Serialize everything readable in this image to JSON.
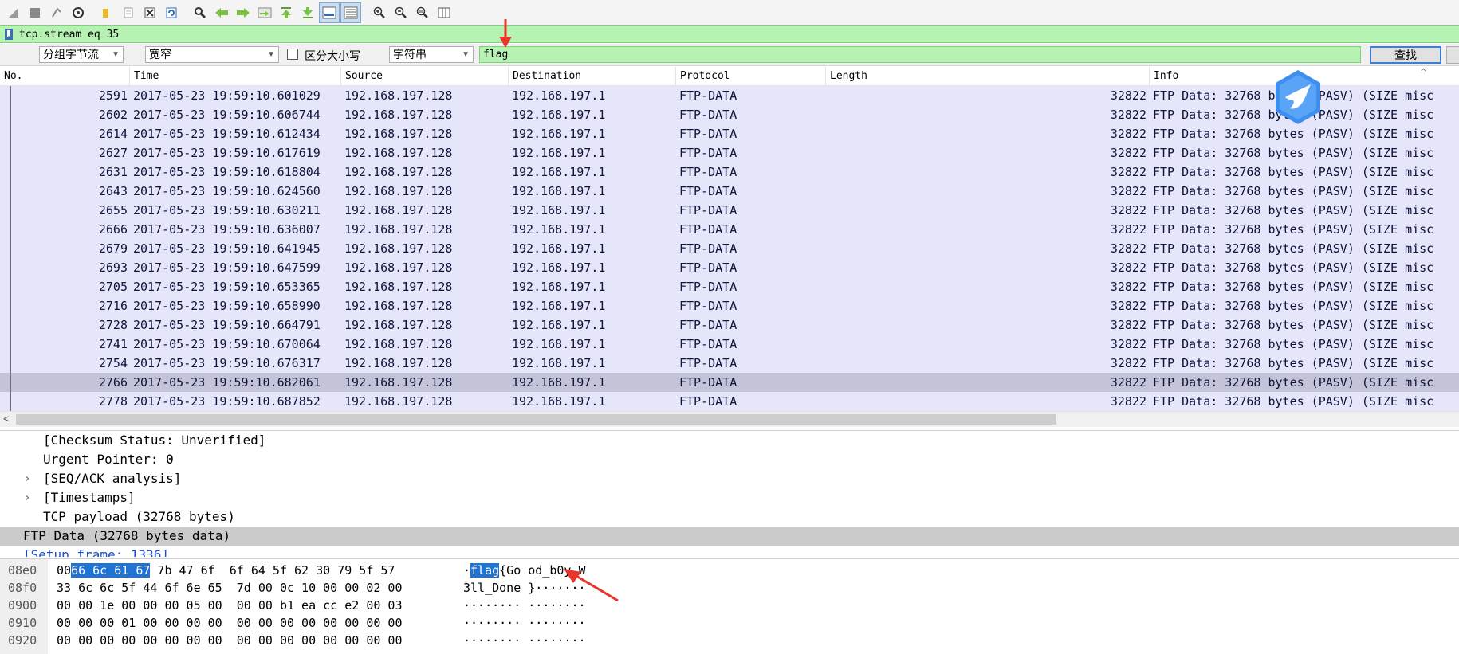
{
  "toolbar": {
    "buttons": [
      "stop-capture-icon",
      "stop-square-icon",
      "restart-capture-icon",
      "capture-options-icon",
      "open-file-icon",
      "save-file-icon",
      "close-file-icon",
      "reload-file-icon",
      "find-packet-icon",
      "go-back-icon",
      "go-forward-icon",
      "go-to-packet-icon",
      "first-packet-icon",
      "last-packet-icon",
      "auto-scroll-icon",
      "colorize-icon",
      "zoom-in-icon",
      "zoom-out-icon",
      "normal-size-icon",
      "resize-columns-icon"
    ]
  },
  "display_filter": {
    "value": "tcp.stream eq 35"
  },
  "find_bar": {
    "search_in": "分组字节流",
    "char_width": "宽窄",
    "case_sensitive_label": "区分大小写",
    "search_type": "字符串",
    "search_value": "flag",
    "find_button": "查找"
  },
  "packet_list": {
    "columns": [
      "No.",
      "Time",
      "Source",
      "Destination",
      "Protocol",
      "Length",
      "Info"
    ],
    "rows": [
      {
        "no": "2591",
        "time": "2017-05-23 19:59:10.601029",
        "src": "192.168.197.128",
        "dst": "192.168.197.1",
        "proto": "FTP-DATA",
        "len": "32822",
        "info": "FTP Data: 32768 bytes (PASV) (SIZE misc"
      },
      {
        "no": "2602",
        "time": "2017-05-23 19:59:10.606744",
        "src": "192.168.197.128",
        "dst": "192.168.197.1",
        "proto": "FTP-DATA",
        "len": "32822",
        "info": "FTP Data: 32768 bytes (PASV) (SIZE misc"
      },
      {
        "no": "2614",
        "time": "2017-05-23 19:59:10.612434",
        "src": "192.168.197.128",
        "dst": "192.168.197.1",
        "proto": "FTP-DATA",
        "len": "32822",
        "info": "FTP Data: 32768 bytes (PASV) (SIZE misc"
      },
      {
        "no": "2627",
        "time": "2017-05-23 19:59:10.617619",
        "src": "192.168.197.128",
        "dst": "192.168.197.1",
        "proto": "FTP-DATA",
        "len": "32822",
        "info": "FTP Data: 32768 bytes (PASV) (SIZE misc"
      },
      {
        "no": "2631",
        "time": "2017-05-23 19:59:10.618804",
        "src": "192.168.197.128",
        "dst": "192.168.197.1",
        "proto": "FTP-DATA",
        "len": "32822",
        "info": "FTP Data: 32768 bytes (PASV) (SIZE misc"
      },
      {
        "no": "2643",
        "time": "2017-05-23 19:59:10.624560",
        "src": "192.168.197.128",
        "dst": "192.168.197.1",
        "proto": "FTP-DATA",
        "len": "32822",
        "info": "FTP Data: 32768 bytes (PASV) (SIZE misc"
      },
      {
        "no": "2655",
        "time": "2017-05-23 19:59:10.630211",
        "src": "192.168.197.128",
        "dst": "192.168.197.1",
        "proto": "FTP-DATA",
        "len": "32822",
        "info": "FTP Data: 32768 bytes (PASV) (SIZE misc"
      },
      {
        "no": "2666",
        "time": "2017-05-23 19:59:10.636007",
        "src": "192.168.197.128",
        "dst": "192.168.197.1",
        "proto": "FTP-DATA",
        "len": "32822",
        "info": "FTP Data: 32768 bytes (PASV) (SIZE misc"
      },
      {
        "no": "2679",
        "time": "2017-05-23 19:59:10.641945",
        "src": "192.168.197.128",
        "dst": "192.168.197.1",
        "proto": "FTP-DATA",
        "len": "32822",
        "info": "FTP Data: 32768 bytes (PASV) (SIZE misc"
      },
      {
        "no": "2693",
        "time": "2017-05-23 19:59:10.647599",
        "src": "192.168.197.128",
        "dst": "192.168.197.1",
        "proto": "FTP-DATA",
        "len": "32822",
        "info": "FTP Data: 32768 bytes (PASV) (SIZE misc"
      },
      {
        "no": "2705",
        "time": "2017-05-23 19:59:10.653365",
        "src": "192.168.197.128",
        "dst": "192.168.197.1",
        "proto": "FTP-DATA",
        "len": "32822",
        "info": "FTP Data: 32768 bytes (PASV) (SIZE misc"
      },
      {
        "no": "2716",
        "time": "2017-05-23 19:59:10.658990",
        "src": "192.168.197.128",
        "dst": "192.168.197.1",
        "proto": "FTP-DATA",
        "len": "32822",
        "info": "FTP Data: 32768 bytes (PASV) (SIZE misc"
      },
      {
        "no": "2728",
        "time": "2017-05-23 19:59:10.664791",
        "src": "192.168.197.128",
        "dst": "192.168.197.1",
        "proto": "FTP-DATA",
        "len": "32822",
        "info": "FTP Data: 32768 bytes (PASV) (SIZE misc"
      },
      {
        "no": "2741",
        "time": "2017-05-23 19:59:10.670064",
        "src": "192.168.197.128",
        "dst": "192.168.197.1",
        "proto": "FTP-DATA",
        "len": "32822",
        "info": "FTP Data: 32768 bytes (PASV) (SIZE misc"
      },
      {
        "no": "2754",
        "time": "2017-05-23 19:59:10.676317",
        "src": "192.168.197.128",
        "dst": "192.168.197.1",
        "proto": "FTP-DATA",
        "len": "32822",
        "info": "FTP Data: 32768 bytes (PASV) (SIZE misc"
      },
      {
        "no": "2766",
        "time": "2017-05-23 19:59:10.682061",
        "src": "192.168.197.128",
        "dst": "192.168.197.1",
        "proto": "FTP-DATA",
        "len": "32822",
        "info": "FTP Data: 32768 bytes (PASV) (SIZE misc",
        "selected": true
      },
      {
        "no": "2778",
        "time": "2017-05-23 19:59:10.687852",
        "src": "192.168.197.128",
        "dst": "192.168.197.1",
        "proto": "FTP-DATA",
        "len": "32822",
        "info": "FTP Data: 32768 bytes (PASV) (SIZE misc"
      }
    ]
  },
  "packet_details": [
    {
      "text": "[Checksum Status: Unverified]",
      "level": 1
    },
    {
      "text": "Urgent Pointer: 0",
      "level": 1
    },
    {
      "text": "[SEQ/ACK analysis]",
      "level": 1,
      "expandable": true
    },
    {
      "text": "[Timestamps]",
      "level": 1,
      "expandable": true
    },
    {
      "text": "TCP payload (32768 bytes)",
      "level": 1
    },
    {
      "text": "FTP Data (32768 bytes data)",
      "level": 0,
      "selected": true
    },
    {
      "text": "[Setup frame: 1336]",
      "level": 0,
      "link": true
    }
  ],
  "packet_bytes": [
    {
      "offset": "08e0",
      "hex": [
        [
          "00",
          ""
        ],
        [
          "66 6c 61 67",
          "hl"
        ],
        [
          " 7b 47 6f  6f 64 5f 62 30 79 5f 57",
          ""
        ]
      ],
      "ascii": [
        [
          "·",
          ""
        ],
        [
          "flag",
          "hl"
        ],
        [
          "{Go od_b0y_W",
          ""
        ]
      ]
    },
    {
      "offset": "08f0",
      "hex": [
        [
          "33 6c 6c 5f 44 6f 6e 65  7d 00 0c 10 00 00 02 00",
          ""
        ]
      ],
      "ascii": [
        [
          "3ll_Done }·······",
          ""
        ]
      ]
    },
    {
      "offset": "0900",
      "hex": [
        [
          "00 00 1e 00 00 00 05 00  00 00 b1 ea cc e2 00 03",
          ""
        ]
      ],
      "ascii": [
        [
          "········ ········",
          ""
        ]
      ]
    },
    {
      "offset": "0910",
      "hex": [
        [
          "00 00 00 01 00 00 00 00  00 00 00 00 00 00 00 00",
          ""
        ]
      ],
      "ascii": [
        [
          "········ ········",
          ""
        ]
      ]
    },
    {
      "offset": "0920",
      "hex": [
        [
          "00 00 00 00 00 00 00 00  00 00 00 00 00 00 00 00",
          ""
        ]
      ],
      "ascii": [
        [
          "········ ········",
          ""
        ]
      ]
    }
  ],
  "colors": {
    "accent": "#1f73d2",
    "filter_ok": "#b6f3b3",
    "row_bg": "#e6e6fb",
    "row_selected": "#c4c4d9",
    "annotation": "#e8352b"
  }
}
